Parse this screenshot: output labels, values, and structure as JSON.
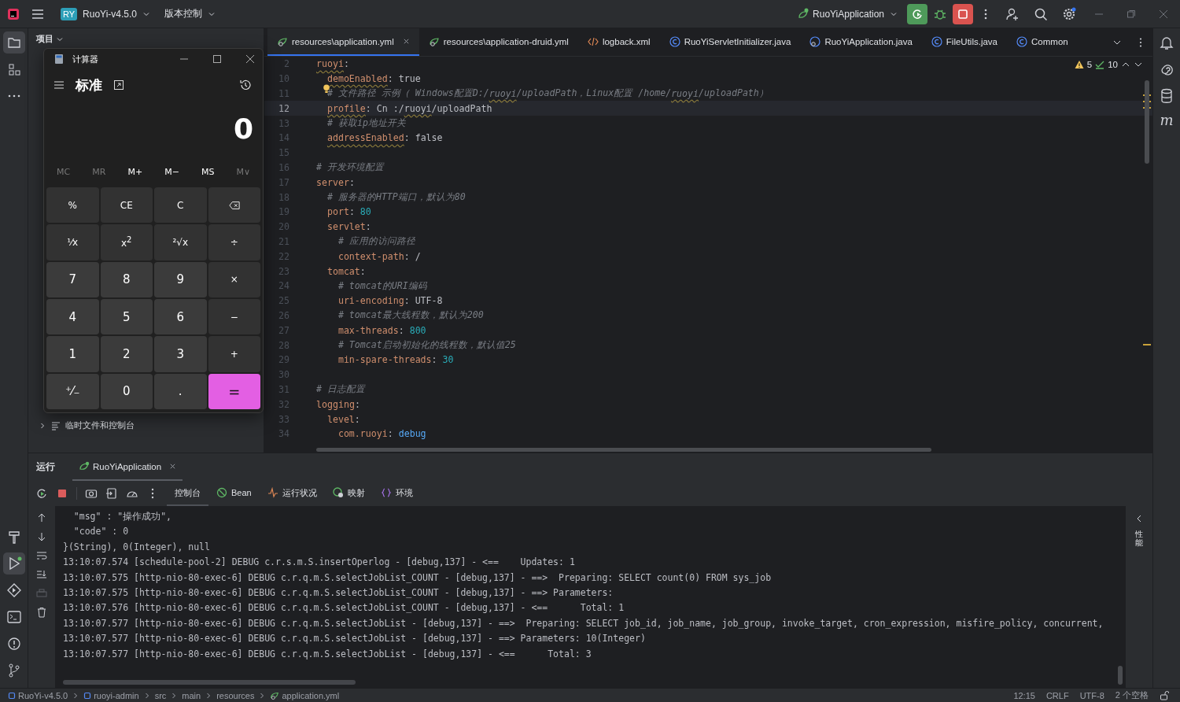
{
  "topbar": {
    "project": {
      "badge": "RY",
      "name": "RuoYi-v4.5.0"
    },
    "vcs": "版本控制",
    "run_config": "RuoYiApplication"
  },
  "project_panel": {
    "title": "项目",
    "bottom_item": "临时文件和控制台"
  },
  "calculator": {
    "title": "计算器",
    "mode": "标准",
    "display": "0",
    "memory": [
      {
        "label": "MC",
        "disabled": true
      },
      {
        "label": "MR",
        "disabled": true
      },
      {
        "label": "M+",
        "disabled": false
      },
      {
        "label": "M−",
        "disabled": false
      },
      {
        "label": "MS",
        "disabled": false
      },
      {
        "label": "M∨",
        "disabled": true
      }
    ],
    "keys": [
      {
        "label": "%",
        "kind": "op"
      },
      {
        "label": "CE",
        "kind": "op"
      },
      {
        "label": "C",
        "kind": "op"
      },
      {
        "kind": "backspace"
      },
      {
        "label": "⅟x",
        "kind": "op"
      },
      {
        "label": "x$^{2}$",
        "kind": "op"
      },
      {
        "label": "²√x",
        "kind": "op"
      },
      {
        "label": "÷",
        "kind": "op"
      },
      {
        "label": "7",
        "kind": "num"
      },
      {
        "label": "8",
        "kind": "num"
      },
      {
        "label": "9",
        "kind": "num"
      },
      {
        "label": "×",
        "kind": "op"
      },
      {
        "label": "4",
        "kind": "num"
      },
      {
        "label": "5",
        "kind": "num"
      },
      {
        "label": "6",
        "kind": "num"
      },
      {
        "label": "−",
        "kind": "op"
      },
      {
        "label": "1",
        "kind": "num"
      },
      {
        "label": "2",
        "kind": "num"
      },
      {
        "label": "3",
        "kind": "num"
      },
      {
        "label": "+",
        "kind": "op"
      },
      {
        "label": "⁺⁄₋",
        "kind": "num"
      },
      {
        "label": "0",
        "kind": "num"
      },
      {
        "label": ".",
        "kind": "num"
      },
      {
        "label": "=",
        "kind": "equals"
      }
    ]
  },
  "editor": {
    "tabs": [
      {
        "label": "resources\\application.yml",
        "kind": "yml",
        "selected": true
      },
      {
        "label": "resources\\application-druid.yml",
        "kind": "yml",
        "selected": false
      },
      {
        "label": "logback.xml",
        "kind": "xml",
        "selected": false
      },
      {
        "label": "RuoYiServletInitializer.java",
        "kind": "class",
        "selected": false
      },
      {
        "label": "RuoYiApplication.java",
        "kind": "app",
        "selected": false
      },
      {
        "label": "FileUtils.java",
        "kind": "class",
        "selected": false
      },
      {
        "label": "Common",
        "kind": "class",
        "selected": false
      }
    ],
    "warnings": "5",
    "checks": "10",
    "lines": [
      {
        "n": "2",
        "current": false,
        "segs": [
          {
            "kind": "key_typo",
            "t": "ruoyi"
          },
          {
            "kind": "punct",
            "t": ":"
          }
        ],
        "children": [
          {
            "n": "10",
            "current": false,
            "segs": [
              {
                "kind": "key_typo",
                "t": "demoEnabled"
              },
              {
                "kind": "punct",
                "t": ": "
              },
              {
                "kind": "value",
                "t": "true"
              }
            ]
          },
          {
            "n": "11",
            "current": false,
            "bulb": true,
            "segs": [
              {
                "kind": "comment",
                "t": "# 文件路径 示例（ Windows配置D:/"
              },
              {
                "kind": "comment_typo",
                "t": "ruoyi"
              },
              {
                "kind": "comment",
                "t": "/uploadPath，Linux配置 /home/"
              },
              {
                "kind": "comment_typo",
                "t": "ruoyi"
              },
              {
                "kind": "comment",
                "t": "/uploadPath）"
              }
            ]
          },
          {
            "n": "12",
            "current": true,
            "segs": [
              {
                "kind": "key_typo",
                "t": "profile"
              },
              {
                "kind": "punct",
                "t": ": "
              },
              {
                "kind": "value",
                "t": "Cn :/"
              },
              {
                "kind": "value_typo",
                "t": "ruoyi"
              },
              {
                "kind": "value",
                "t": "/uploadPath"
              }
            ]
          },
          {
            "n": "13",
            "current": false,
            "segs": [
              {
                "kind": "comment",
                "t": "# 获取ip地址开关"
              }
            ]
          },
          {
            "n": "14",
            "current": false,
            "segs": [
              {
                "kind": "key_typo",
                "t": "addressEnabled"
              },
              {
                "kind": "punct",
                "t": ": "
              },
              {
                "kind": "value",
                "t": "false"
              }
            ]
          }
        ]
      },
      {
        "n": "15",
        "current": false
      },
      {
        "n": "16",
        "current": false,
        "segs": [
          {
            "kind": "comment",
            "t": "# 开发环境配置"
          }
        ]
      },
      {
        "n": "17",
        "current": false,
        "segs": [
          {
            "kind": "key",
            "t": "server"
          },
          {
            "kind": "punct",
            "t": ":"
          }
        ],
        "children": [
          {
            "n": "18",
            "current": false,
            "segs": [
              {
                "kind": "comment",
                "t": "# 服务器的HTTP端口，默认为80"
              }
            ]
          },
          {
            "n": "19",
            "current": false,
            "segs": [
              {
                "kind": "key",
                "t": "port"
              },
              {
                "kind": "punct",
                "t": ": "
              },
              {
                "kind": "number",
                "t": "80"
              }
            ]
          },
          {
            "n": "20",
            "current": false,
            "segs": [
              {
                "kind": "key",
                "t": "servlet"
              },
              {
                "kind": "punct",
                "t": ":"
              }
            ],
            "children": [
              {
                "n": "21",
                "current": false,
                "segs": [
                  {
                    "kind": "comment",
                    "t": "# 应用的访问路径"
                  }
                ]
              },
              {
                "n": "22",
                "current": false,
                "segs": [
                  {
                    "kind": "key",
                    "t": "context-path"
                  },
                  {
                    "kind": "punct",
                    "t": ": "
                  },
                  {
                    "kind": "value",
                    "t": "/"
                  }
                ]
              }
            ]
          },
          {
            "n": "23",
            "current": false,
            "segs": [
              {
                "kind": "key",
                "t": "tomcat"
              },
              {
                "kind": "punct",
                "t": ":"
              }
            ],
            "children": [
              {
                "n": "24",
                "current": false,
                "segs": [
                  {
                    "kind": "comment",
                    "t": "# tomcat的URI编码"
                  }
                ]
              },
              {
                "n": "25",
                "current": false,
                "segs": [
                  {
                    "kind": "key",
                    "t": "uri-encoding"
                  },
                  {
                    "kind": "punct",
                    "t": ": "
                  },
                  {
                    "kind": "value",
                    "t": "UTF-8"
                  }
                ]
              },
              {
                "n": "26",
                "current": false,
                "segs": [
                  {
                    "kind": "comment",
                    "t": "# tomcat最大线程数，默认为200"
                  }
                ]
              },
              {
                "n": "27",
                "current": false,
                "segs": [
                  {
                    "kind": "key",
                    "t": "max-threads"
                  },
                  {
                    "kind": "punct",
                    "t": ": "
                  },
                  {
                    "kind": "number",
                    "t": "800"
                  }
                ]
              },
              {
                "n": "28",
                "current": false,
                "segs": [
                  {
                    "kind": "comment",
                    "t": "# Tomcat启动初始化的线程数，默认值25"
                  }
                ]
              },
              {
                "n": "29",
                "current": false,
                "segs": [
                  {
                    "kind": "key",
                    "t": "min-spare-threads"
                  },
                  {
                    "kind": "punct",
                    "t": ": "
                  },
                  {
                    "kind": "number",
                    "t": "30"
                  }
                ]
              }
            ]
          }
        ]
      },
      {
        "n": "30",
        "current": false
      },
      {
        "n": "31",
        "current": false,
        "segs": [
          {
            "kind": "comment",
            "t": "# 日志配置"
          }
        ]
      },
      {
        "n": "32",
        "current": false,
        "segs": [
          {
            "kind": "key",
            "t": "logging"
          },
          {
            "kind": "punct",
            "t": ":"
          }
        ],
        "children": [
          {
            "n": "33",
            "current": false,
            "segs": [
              {
                "kind": "key",
                "t": "level"
              },
              {
                "kind": "punct",
                "t": ":"
              }
            ],
            "children": [
              {
                "n": "34",
                "current": false,
                "segs": [
                  {
                    "kind": "key",
                    "t": "com.ruoyi"
                  },
                  {
                    "kind": "punct",
                    "t": ": "
                  },
                  {
                    "kind": "enum",
                    "t": "debug"
                  }
                ]
              }
            ]
          }
        ]
      }
    ]
  },
  "right_strip": {
    "maven_label": "m"
  },
  "run_panel": {
    "title": "运行",
    "tab": "RuoYiApplication",
    "tabs": [
      {
        "label": "控制台",
        "kind": "plain",
        "selected": true
      },
      {
        "label": "Bean",
        "kind": "bean",
        "selected": false
      },
      {
        "label": "运行状况",
        "kind": "health",
        "selected": false
      },
      {
        "label": "映射",
        "kind": "mapping",
        "selected": false
      },
      {
        "label": "环境",
        "kind": "env",
        "selected": false
      }
    ],
    "console": [
      "  \"msg\" : \"操作成功\",",
      "  \"code\" : 0",
      "}(String), 0(Integer), null",
      "13:10:07.574 [schedule-pool-2] DEBUG c.r.s.m.S.insertOperlog - [debug,137] - <==    Updates: 1",
      "13:10:07.575 [http-nio-80-exec-6] DEBUG c.r.q.m.S.selectJobList_COUNT - [debug,137] - ==>  Preparing: SELECT count(0) FROM sys_job",
      "13:10:07.575 [http-nio-80-exec-6] DEBUG c.r.q.m.S.selectJobList_COUNT - [debug,137] - ==> Parameters:",
      "13:10:07.576 [http-nio-80-exec-6] DEBUG c.r.q.m.S.selectJobList_COUNT - [debug,137] - <==      Total: 1",
      "13:10:07.577 [http-nio-80-exec-6] DEBUG c.r.q.m.S.selectJobList - [debug,137] - ==>  Preparing: SELECT job_id, job_name, job_group, invoke_target, cron_expression, misfire_policy, concurrent,",
      "13:10:07.577 [http-nio-80-exec-6] DEBUG c.r.q.m.S.selectJobList - [debug,137] - ==> Parameters: 10(Integer)",
      "13:10:07.577 [http-nio-80-exec-6] DEBUG c.r.q.m.S.selectJobList - [debug,137] - <==      Total: 3"
    ],
    "side_label": "性能"
  },
  "status_bar": {
    "breadcrumbs": [
      {
        "label": "RuoYi-v4.5.0",
        "kind": "module"
      },
      {
        "label": "ruoyi-admin",
        "kind": "module"
      },
      {
        "label": "src",
        "kind": "plain"
      },
      {
        "label": "main",
        "kind": "plain"
      },
      {
        "label": "resources",
        "kind": "plain"
      },
      {
        "label": "application.yml",
        "kind": "yml"
      }
    ],
    "position": "12:15",
    "line_ending": "CRLF",
    "encoding": "UTF-8",
    "indent": "2 个空格"
  }
}
